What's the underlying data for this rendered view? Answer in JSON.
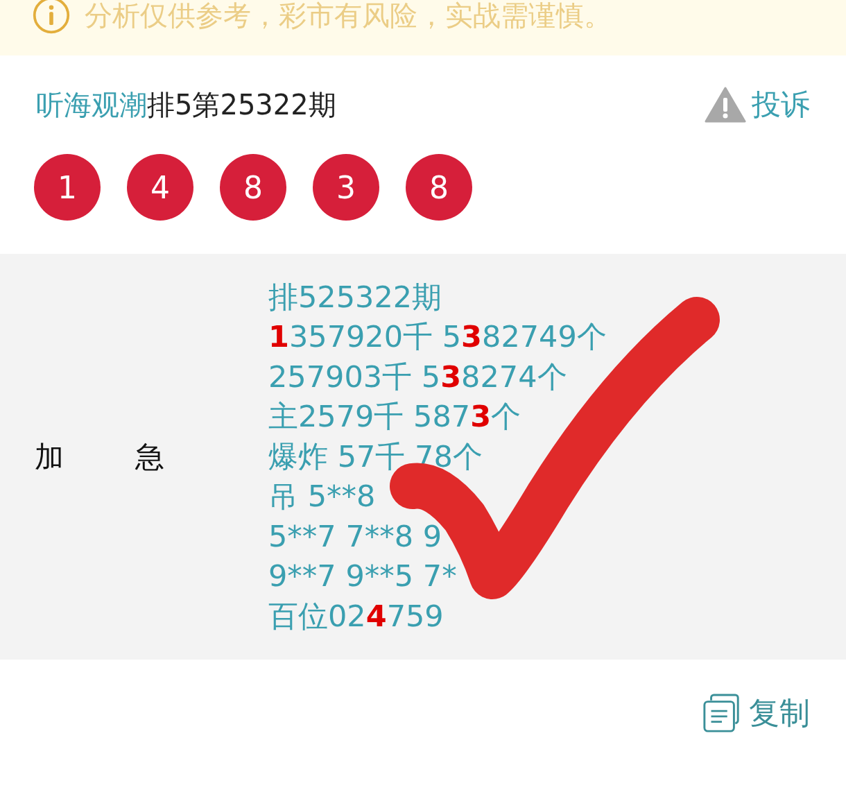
{
  "notice": {
    "text": "分析仅供参考，彩市有风险，实战需谨慎。"
  },
  "header": {
    "author": "听海观潮",
    "title": "排5第25322期",
    "report": "投诉"
  },
  "balls": [
    "1",
    "4",
    "8",
    "3",
    "8"
  ],
  "post": {
    "label": "加急",
    "lines": [
      {
        "parts": [
          {
            "text": "排525322期",
            "highlight": false
          }
        ]
      },
      {
        "parts": [
          {
            "text": "1",
            "highlight": true
          },
          {
            "text": "357920千 5",
            "highlight": false
          },
          {
            "text": "3",
            "highlight": true
          },
          {
            "text": "82749个",
            "highlight": false
          }
        ]
      },
      {
        "parts": [
          {
            "text": "257903千 5",
            "highlight": false
          },
          {
            "text": "3",
            "highlight": true
          },
          {
            "text": "8274个",
            "highlight": false
          }
        ]
      },
      {
        "parts": [
          {
            "text": "主2579千 587",
            "highlight": false
          },
          {
            "text": "3",
            "highlight": true
          },
          {
            "text": "个",
            "highlight": false
          }
        ]
      },
      {
        "parts": [
          {
            "text": "爆炸 57千 78个",
            "highlight": false
          }
        ]
      },
      {
        "parts": [
          {
            "text": "吊 5**8",
            "highlight": false
          }
        ]
      },
      {
        "parts": [
          {
            "text": "5**7 7**8 9",
            "highlight": false
          }
        ]
      },
      {
        "parts": [
          {
            "text": "9**7 9**5 7*",
            "highlight": false
          }
        ]
      },
      {
        "parts": [
          {
            "text": "百位02",
            "highlight": false
          },
          {
            "text": "4",
            "highlight": true
          },
          {
            "text": "759",
            "highlight": false
          }
        ]
      }
    ]
  },
  "copy": {
    "label": "复制"
  }
}
